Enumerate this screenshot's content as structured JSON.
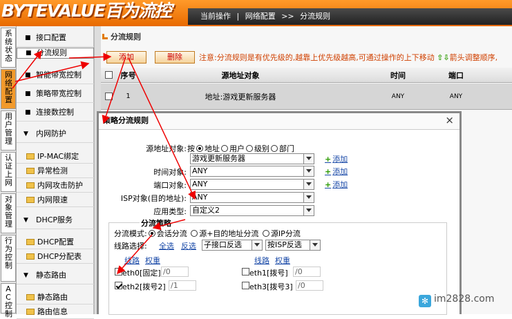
{
  "brand": {
    "logo": "BYTEVALUE百为流控"
  },
  "breadcrumb": {
    "current_label": "当前操作",
    "section": "网络配置",
    "separator": ">>",
    "page": "分流规则"
  },
  "vtabs": [
    "系统状态",
    "网络配置",
    "用户管理",
    "认证上网",
    "对象管理",
    "行为控制",
    "AC控制"
  ],
  "sidebar": {
    "l1": [
      "接口配置",
      "分流规则",
      "智能带宽控制",
      "策略带宽控制",
      "连接数控制"
    ],
    "g_intranet": "内网防护",
    "intranet_items": [
      "IP-MAC绑定",
      "异常检测",
      "内网攻击防护",
      "内网限速"
    ],
    "g_dhcp": "DHCP服务",
    "dhcp_items": [
      "DHCP配置",
      "DHCP分配表"
    ],
    "g_route": "静态路由",
    "route_items": [
      "静态路由",
      "路由信息"
    ]
  },
  "page": {
    "title": "分流规则",
    "add_label": "添加",
    "delete_label": "删除",
    "notice": "注意:分流规则是有优先级的,越靠上优先级越高,可通过操作的上下移动",
    "notice_tail": "箭头调整顺序,",
    "table": {
      "headers": {
        "seq": "序号",
        "src": "源地址对象",
        "time": "时间",
        "port": "端口"
      },
      "rows": [
        {
          "seq": "1",
          "src": "地址:游戏更新服务器",
          "time": "ANY",
          "port": "ANY"
        }
      ]
    }
  },
  "dialog": {
    "title": "策略分流规则",
    "close": "×",
    "src_label": "源地址对象:",
    "src_by": "按",
    "src_opts": [
      "地址",
      "用户",
      "级别",
      "部门"
    ],
    "src_value": "游戏更新服务器",
    "time_label": "时间对象:",
    "time_value": "ANY",
    "port_label": "端口对象:",
    "port_value": "ANY",
    "isp_label": "ISP对象(目的地址):",
    "isp_value": "ANY",
    "app_label": "应用类型:",
    "app_value": "自定义2",
    "add_link": "添加",
    "strategy_title": "分流策略",
    "mode_label": "分流模式:",
    "mode_opts": [
      "会话分流",
      "源+目的地址分流",
      "源IP分流"
    ],
    "line_label": "线路选择:",
    "all": "全选",
    "invert": "反选",
    "sub_select": "子接口反选",
    "isp_select": "按ISP反选",
    "col_line": "线路",
    "col_weight": "权重",
    "lines": [
      {
        "name": "eth0[固定]",
        "weight": "0",
        "checked": false
      },
      {
        "name": "eth1[拨号]",
        "weight": "0",
        "checked": false
      },
      {
        "name": "eth2[拨号2]",
        "weight": "1",
        "checked": true
      },
      {
        "name": "eth3[拨号3]",
        "weight": "0",
        "checked": false
      }
    ]
  },
  "watermark": "im2828.com"
}
